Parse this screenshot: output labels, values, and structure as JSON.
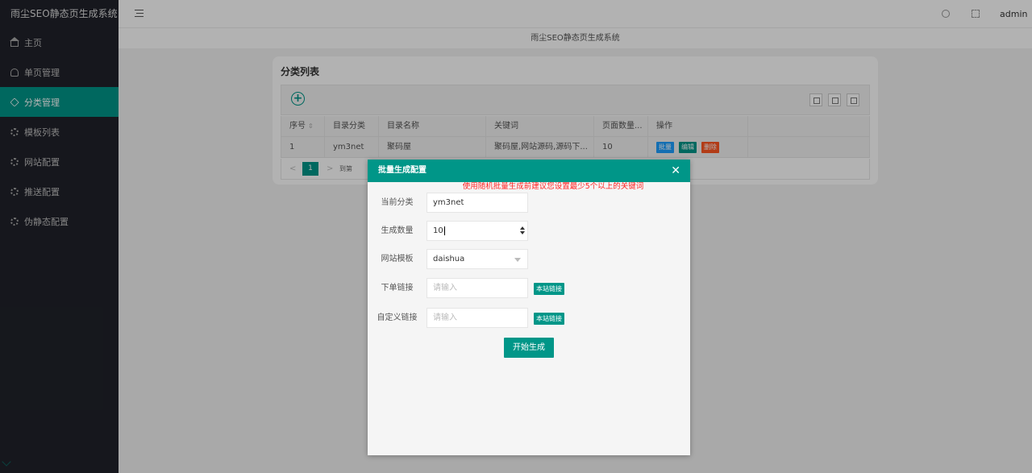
{
  "app": {
    "title": "雨尘SEO静态页生成系统",
    "user": "admin"
  },
  "sidebar": {
    "items": [
      {
        "label": "主页",
        "icon": "home-icon",
        "active": false
      },
      {
        "label": "单页管理",
        "icon": "user-icon",
        "active": false
      },
      {
        "label": "分类管理",
        "icon": "tag-icon",
        "active": true
      },
      {
        "label": "模板列表",
        "icon": "gear-icon",
        "active": false
      },
      {
        "label": "网站配置",
        "icon": "gear-icon",
        "active": false
      },
      {
        "label": "推送配置",
        "icon": "gear-icon",
        "active": false
      },
      {
        "label": "伪静态配置",
        "icon": "gear-icon",
        "active": false
      }
    ]
  },
  "header": {
    "subtitle": "雨尘SEO静态页生成系统"
  },
  "card": {
    "title": "分类列表",
    "add_symbol": "+",
    "columns": [
      "序号",
      "目录分类",
      "目录名称",
      "关键词",
      "页面数量...",
      "操作"
    ],
    "rows": [
      {
        "id": "1",
        "dir_category": "ym3net",
        "dir_name": "聚码屋",
        "keywords": "聚码屋,网站源码,源码下...",
        "page_count": "10"
      }
    ],
    "actions": {
      "batch": "批量",
      "edit": "编辑",
      "delete": "删除"
    },
    "pager": {
      "prev": "<",
      "current": "1",
      "next": ">",
      "goto": "到第"
    }
  },
  "dialog": {
    "title": "批量生成配置",
    "close": "✕",
    "tip": "使用随机批量生成前建议您设置最少5个以上的关键词",
    "fields": {
      "category_label": "当前分类",
      "category_value": "ym3net",
      "count_label": "生成数量",
      "count_value": "10",
      "template_label": "网站模板",
      "template_value": "daishua",
      "order_link_label": "下单链接",
      "order_link_placeholder": "请输入",
      "custom_link_label": "自定义链接",
      "custom_link_placeholder": "请输入",
      "site_link_button": "本站链接"
    },
    "submit": "开始生成"
  },
  "colors": {
    "accent": "#009688",
    "sidebar_bg": "#20222a",
    "danger": "#ff5722",
    "info": "#1e9fff",
    "tip": "#ff2222"
  }
}
